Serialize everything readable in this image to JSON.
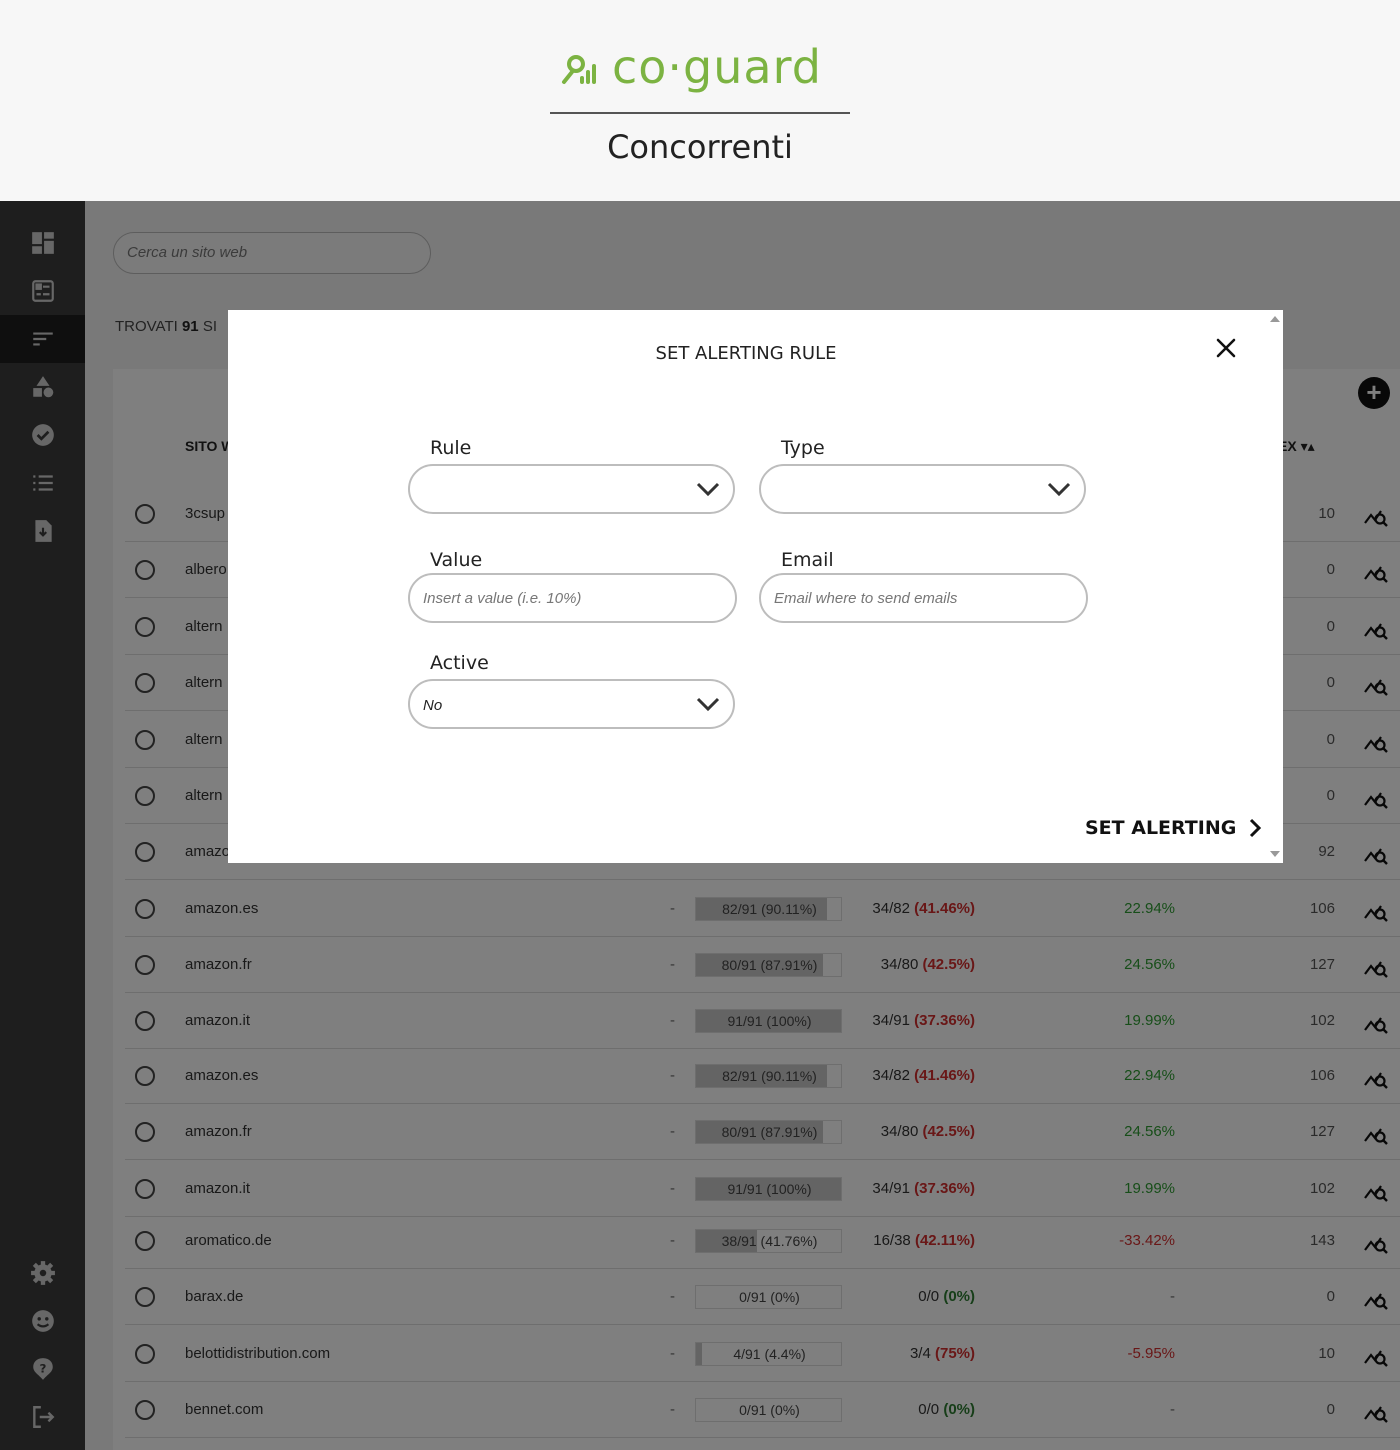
{
  "header": {
    "logo_text": "co·guard",
    "page_title": "Concorrenti"
  },
  "colors": {
    "brand": "#7cb342",
    "sidebar": "#3d3d3d",
    "negative": "#d32f2f",
    "positive": "#2e9d32"
  },
  "sidebar": {
    "top_items": [
      {
        "icon": "dashboard-icon"
      },
      {
        "icon": "report-icon"
      },
      {
        "icon": "sort-list-icon"
      },
      {
        "icon": "shapes-icon"
      },
      {
        "icon": "verified-badge-icon"
      },
      {
        "icon": "list-icon"
      },
      {
        "icon": "download-file-icon"
      }
    ],
    "bottom_items": [
      {
        "icon": "gear-icon"
      },
      {
        "icon": "support-icon"
      },
      {
        "icon": "help-icon"
      },
      {
        "icon": "logout-icon"
      }
    ]
  },
  "main": {
    "search_placeholder": "Cerca un sito web",
    "found_prefix": "TROVATI",
    "found_count": "91",
    "found_suffix": "SI",
    "headers": {
      "site": "SITO W",
      "index": "EX ▾▴"
    },
    "rows": [
      {
        "site": "3csup",
        "dash": "",
        "bar": "",
        "fill": 0,
        "ratio": "",
        "ratio_pct": "",
        "pct": "",
        "idx": "10"
      },
      {
        "site": "albero",
        "dash": "",
        "bar": "",
        "fill": 0,
        "ratio": "",
        "ratio_pct": "",
        "pct": "",
        "idx": "0"
      },
      {
        "site": "altern",
        "dash": "",
        "bar": "",
        "fill": 0,
        "ratio": "",
        "ratio_pct": "",
        "pct": "",
        "idx": "0"
      },
      {
        "site": "altern",
        "dash": "",
        "bar": "",
        "fill": 0,
        "ratio": "",
        "ratio_pct": "",
        "pct": "",
        "idx": "0"
      },
      {
        "site": "altern",
        "dash": "",
        "bar": "",
        "fill": 0,
        "ratio": "",
        "ratio_pct": "",
        "pct": "",
        "idx": "0"
      },
      {
        "site": "altern",
        "dash": "",
        "bar": "",
        "fill": 0,
        "ratio": "",
        "ratio_pct": "",
        "pct": "",
        "idx": "0"
      },
      {
        "site": "amazo",
        "dash": "",
        "bar": "",
        "fill": 0,
        "ratio": "",
        "ratio_pct": "",
        "pct": "",
        "idx": "92"
      },
      {
        "site": "amazon.es",
        "dash": "-",
        "bar": "82/91 (90.11%)",
        "fill": 0.9011,
        "ratio": "34/82 ",
        "ratio_pct": "(41.46%)",
        "pct": "22.94%",
        "idx": "106"
      },
      {
        "site": "amazon.fr",
        "dash": "-",
        "bar": "80/91 (87.91%)",
        "fill": 0.8791,
        "ratio": "34/80 ",
        "ratio_pct": "(42.5%)",
        "pct": "24.56%",
        "idx": "127"
      },
      {
        "site": "amazon.it",
        "dash": "-",
        "bar": "91/91 (100%)",
        "fill": 1.0,
        "ratio": "34/91 ",
        "ratio_pct": "(37.36%)",
        "pct": "19.99%",
        "idx": "102"
      },
      {
        "site": "amazon.es",
        "dash": "-",
        "bar": "82/91 (90.11%)",
        "fill": 0.9011,
        "ratio": "34/82 ",
        "ratio_pct": "(41.46%)",
        "pct": "22.94%",
        "idx": "106"
      },
      {
        "site": "amazon.fr",
        "dash": "-",
        "bar": "80/91 (87.91%)",
        "fill": 0.8791,
        "ratio": "34/80 ",
        "ratio_pct": "(42.5%)",
        "pct": "24.56%",
        "idx": "127"
      },
      {
        "site": "amazon.it",
        "dash": "-",
        "bar": "91/91 (100%)",
        "fill": 1.0,
        "ratio": "34/91 ",
        "ratio_pct": "(37.36%)",
        "pct": "19.99%",
        "idx": "102"
      },
      {
        "site": "aromatico.de",
        "dash": "-",
        "bar": "38/91 (41.76%)",
        "fill": 0.4176,
        "ratio": "16/38 ",
        "ratio_pct": "(42.11%)",
        "pct": "-33.42%",
        "idx": "143"
      },
      {
        "site": "barax.de",
        "dash": "-",
        "bar": "0/91 (0%)",
        "fill": 0,
        "ratio": "0/0 ",
        "ratio_pct": "(0%)",
        "pct": "-",
        "idx": "0"
      },
      {
        "site": "belottidistribution.com",
        "dash": "-",
        "bar": "4/91 (4.4%)",
        "fill": 0.044,
        "ratio": "3/4 ",
        "ratio_pct": "(75%)",
        "pct": "-5.95%",
        "idx": "10"
      },
      {
        "site": "bennet.com",
        "dash": "-",
        "bar": "0/91 (0%)",
        "fill": 0,
        "ratio": "0/0 ",
        "ratio_pct": "(0%)",
        "pct": "-",
        "idx": "0"
      }
    ]
  },
  "modal": {
    "title": "SET ALERTING RULE",
    "rule_label": "Rule",
    "rule_value": "",
    "type_label": "Type",
    "type_value": "",
    "value_label": "Value",
    "value_placeholder": "Insert a value (i.e. 10%)",
    "email_label": "Email",
    "email_placeholder": "Email where to send emails",
    "active_label": "Active",
    "active_value": "No",
    "submit_label": "SET ALERTING"
  }
}
